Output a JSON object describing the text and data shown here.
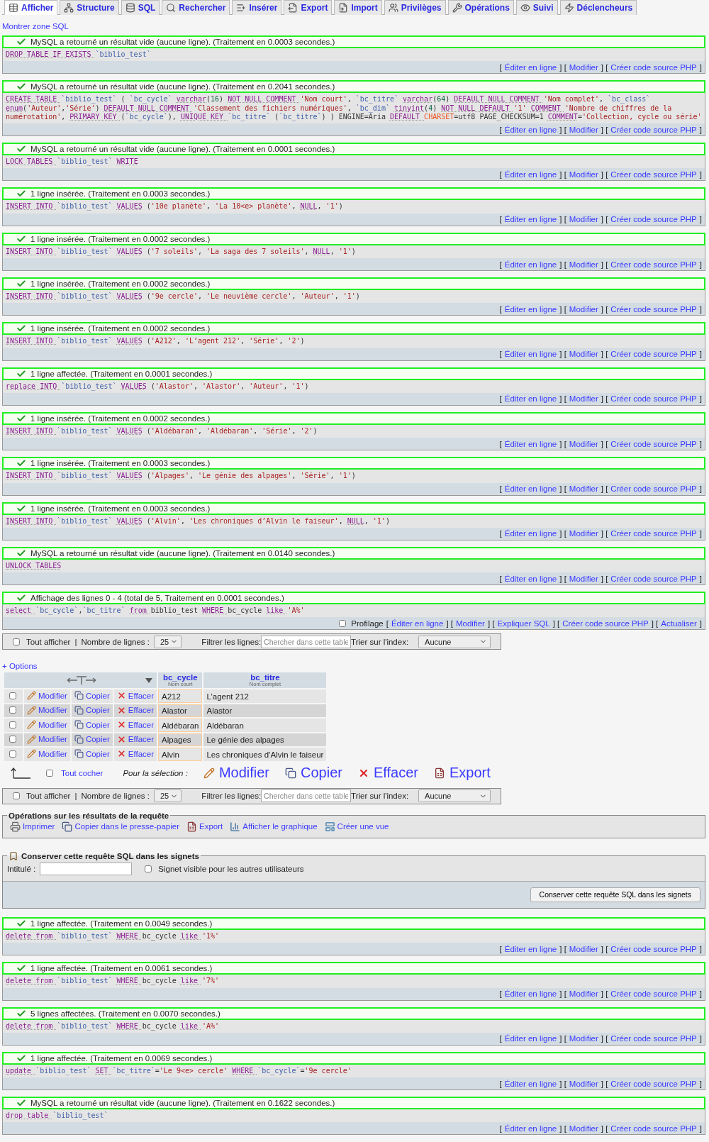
{
  "tabs": [
    {
      "kind": "browse",
      "label": "Afficher",
      "selected": true
    },
    {
      "kind": "structure",
      "label": "Structure",
      "selected": false
    },
    {
      "kind": "sql",
      "label": "SQL",
      "selected": false
    },
    {
      "kind": "search",
      "label": "Rechercher",
      "selected": false
    },
    {
      "kind": "insert",
      "label": "Insérer",
      "selected": false
    },
    {
      "kind": "export",
      "label": "Export",
      "selected": false
    },
    {
      "kind": "import",
      "label": "Import",
      "selected": false
    },
    {
      "kind": "privileges",
      "label": "Privilèges",
      "selected": false
    },
    {
      "kind": "operations",
      "label": "Opérations",
      "selected": false
    },
    {
      "kind": "tracking",
      "label": "Suivi",
      "selected": false
    },
    {
      "kind": "triggers",
      "label": "Déclencheurs",
      "selected": false
    }
  ],
  "sql_toggle": "Montrer zone SQL",
  "queries_before": [
    {
      "message": "MySQL a retourné un résultat vide (aucune ligne). (Traitement en 0.0003 secondes.)",
      "sql": [
        {
          "kw": "DROP TABLE IF EXISTS "
        },
        {
          "id": "`biblio_test`"
        }
      ],
      "actions": [
        {
          "text": "["
        },
        {
          "link": "Éditer en ligne"
        },
        {
          "text": "] ["
        },
        {
          "link": "Modifier"
        },
        {
          "text": "] ["
        },
        {
          "link": "Créer code source PHP"
        },
        {
          "text": "]"
        }
      ]
    },
    {
      "message": "MySQL a retourné un résultat vide (aucune ligne). (Traitement en 0.2041 secondes.)",
      "sql": [
        {
          "kw": "CREATE TABLE "
        },
        {
          "id": "`biblio_test` "
        },
        {
          "op": "( "
        },
        {
          "id": "`bc_cycle` "
        },
        {
          "kw": "varchar"
        },
        {
          "op": "("
        },
        {
          "num": "16"
        },
        {
          "op": ") "
        },
        {
          "kw": "NOT NULL COMMENT "
        },
        {
          "str": "'Nom court'"
        },
        {
          "op": ", "
        },
        {
          "id": "`bc_titre` "
        },
        {
          "kw": "varchar"
        },
        {
          "op": "("
        },
        {
          "num": "64"
        },
        {
          "op": ") "
        },
        {
          "kw": "DEFAULT NULL COMMENT "
        },
        {
          "str": "'Nom complet'"
        },
        {
          "op": ", "
        },
        {
          "id": "`bc_class` "
        },
        {
          "kw": "enum"
        },
        {
          "op": "("
        },
        {
          "str": "'Auteur'"
        },
        {
          "op": ","
        },
        {
          "str": "'Série'"
        },
        {
          "op": ") "
        },
        {
          "kw": "DEFAULT NULL COMMENT "
        },
        {
          "str": "'Classement des fichiers numériques'"
        },
        {
          "op": ", "
        },
        {
          "id": "`bc_dim` "
        },
        {
          "kw": "tinyint"
        },
        {
          "op": "("
        },
        {
          "num": "4"
        },
        {
          "op": ") "
        },
        {
          "kw": "NOT NULL DEFAULT "
        },
        {
          "str": "'1' "
        },
        {
          "kw": "COMMENT "
        },
        {
          "str": "'Nombre de chiffres de la numérotation'"
        },
        {
          "op": ", "
        },
        {
          "kw": "PRIMARY KEY "
        },
        {
          "op": "("
        },
        {
          "id": "`bc_cycle`"
        },
        {
          "op": "), "
        },
        {
          "kw": "UNIQUE KEY "
        },
        {
          "id": "`bc_titre` "
        },
        {
          "op": "("
        },
        {
          "id": "`bc_titre`"
        },
        {
          "op": ") ) ENGINE=Aria "
        },
        {
          "kw": "DEFAULT "
        },
        {
          "var": "CHARSET"
        },
        {
          "op": "=utf8 PAGE_CHECKSUM=1 "
        },
        {
          "kw": "COMMENT"
        },
        {
          "op": "="
        },
        {
          "str": "'Collection, cycle ou série'"
        }
      ],
      "actions": [
        {
          "text": "["
        },
        {
          "link": "Éditer en ligne"
        },
        {
          "text": "] ["
        },
        {
          "link": "Modifier"
        },
        {
          "text": "] ["
        },
        {
          "link": "Créer code source PHP"
        },
        {
          "text": "]"
        }
      ]
    },
    {
      "message": "MySQL a retourné un résultat vide (aucune ligne). (Traitement en 0.0001 secondes.)",
      "sql": [
        {
          "kw": "LOCK TABLES "
        },
        {
          "id": "`biblio_test` "
        },
        {
          "kw": "WRITE"
        }
      ],
      "actions": [
        {
          "text": "["
        },
        {
          "link": "Éditer en ligne"
        },
        {
          "text": "] ["
        },
        {
          "link": "Modifier"
        },
        {
          "text": "] ["
        },
        {
          "link": "Créer code source PHP"
        },
        {
          "text": "]"
        }
      ]
    },
    {
      "message": "1 ligne insérée. (Traitement en 0.0003 secondes.)",
      "sql": [
        {
          "kw": "INSERT INTO "
        },
        {
          "id": "`biblio_test` "
        },
        {
          "kw": "VALUES"
        },
        {
          "op": " ("
        },
        {
          "str": "'10e planète'"
        },
        {
          "op": ", "
        },
        {
          "str": "'La 10<e> planète'"
        },
        {
          "op": ", "
        },
        {
          "kw": "NULL"
        },
        {
          "op": ", "
        },
        {
          "str": "'1'"
        },
        {
          "op": ")"
        }
      ],
      "actions": [
        {
          "text": "["
        },
        {
          "link": "Éditer en ligne"
        },
        {
          "text": "] ["
        },
        {
          "link": "Modifier"
        },
        {
          "text": "] ["
        },
        {
          "link": "Créer code source PHP"
        },
        {
          "text": "]"
        }
      ]
    },
    {
      "message": "1 ligne insérée. (Traitement en 0.0002 secondes.)",
      "sql": [
        {
          "kw": "INSERT INTO "
        },
        {
          "id": "`biblio_test` "
        },
        {
          "kw": "VALUES"
        },
        {
          "op": " ("
        },
        {
          "str": "'7 soleils'"
        },
        {
          "op": ", "
        },
        {
          "str": "'La saga des 7 soleils'"
        },
        {
          "op": ", "
        },
        {
          "kw": "NULL"
        },
        {
          "op": ", "
        },
        {
          "str": "'1'"
        },
        {
          "op": ")"
        }
      ],
      "actions": [
        {
          "text": "["
        },
        {
          "link": "Éditer en ligne"
        },
        {
          "text": "] ["
        },
        {
          "link": "Modifier"
        },
        {
          "text": "] ["
        },
        {
          "link": "Créer code source PHP"
        },
        {
          "text": "]"
        }
      ]
    },
    {
      "message": "1 ligne insérée. (Traitement en 0.0002 secondes.)",
      "sql": [
        {
          "kw": "INSERT INTO "
        },
        {
          "id": "`biblio_test` "
        },
        {
          "kw": "VALUES"
        },
        {
          "op": " ("
        },
        {
          "str": "'9e cercle'"
        },
        {
          "op": ", "
        },
        {
          "str": "'Le neuvième cercle'"
        },
        {
          "op": ", "
        },
        {
          "str": "'Auteur'"
        },
        {
          "op": ", "
        },
        {
          "str": "'1'"
        },
        {
          "op": ")"
        }
      ],
      "actions": [
        {
          "text": "["
        },
        {
          "link": "Éditer en ligne"
        },
        {
          "text": "] ["
        },
        {
          "link": "Modifier"
        },
        {
          "text": "] ["
        },
        {
          "link": "Créer code source PHP"
        },
        {
          "text": "]"
        }
      ]
    },
    {
      "message": "1 ligne insérée. (Traitement en 0.0002 secondes.)",
      "sql": [
        {
          "kw": "INSERT INTO "
        },
        {
          "id": "`biblio_test` "
        },
        {
          "kw": "VALUES"
        },
        {
          "op": " ("
        },
        {
          "str": "'A212'"
        },
        {
          "op": ", "
        },
        {
          "str": "'L’agent 212'"
        },
        {
          "op": ", "
        },
        {
          "str": "'Série'"
        },
        {
          "op": ", "
        },
        {
          "str": "'2'"
        },
        {
          "op": ")"
        }
      ],
      "actions": [
        {
          "text": "["
        },
        {
          "link": "Éditer en ligne"
        },
        {
          "text": "] ["
        },
        {
          "link": "Modifier"
        },
        {
          "text": "] ["
        },
        {
          "link": "Créer code source PHP"
        },
        {
          "text": "]"
        }
      ]
    },
    {
      "message": "1 ligne affectée. (Traitement en 0.0001 secondes.)",
      "sql": [
        {
          "kw": "replace INTO "
        },
        {
          "id": "`biblio_test` "
        },
        {
          "kw": "VALUES"
        },
        {
          "op": " ("
        },
        {
          "str": "'Alastor'"
        },
        {
          "op": ", "
        },
        {
          "str": "'Alastor'"
        },
        {
          "op": ", "
        },
        {
          "str": "'Auteur'"
        },
        {
          "op": ", "
        },
        {
          "str": "'1'"
        },
        {
          "op": ")"
        }
      ],
      "actions": [
        {
          "text": "["
        },
        {
          "link": "Éditer en ligne"
        },
        {
          "text": "] ["
        },
        {
          "link": "Modifier"
        },
        {
          "text": "] ["
        },
        {
          "link": "Créer code source PHP"
        },
        {
          "text": "]"
        }
      ]
    },
    {
      "message": "1 ligne insérée. (Traitement en 0.0002 secondes.)",
      "sql": [
        {
          "kw": "INSERT INTO "
        },
        {
          "id": "`biblio_test` "
        },
        {
          "kw": "VALUES"
        },
        {
          "op": " ("
        },
        {
          "str": "'Aldébaran'"
        },
        {
          "op": ", "
        },
        {
          "str": "'Aldébaran'"
        },
        {
          "op": ", "
        },
        {
          "str": "'Série'"
        },
        {
          "op": ", "
        },
        {
          "str": "'2'"
        },
        {
          "op": ")"
        }
      ],
      "actions": [
        {
          "text": "["
        },
        {
          "link": "Éditer en ligne"
        },
        {
          "text": "] ["
        },
        {
          "link": "Modifier"
        },
        {
          "text": "] ["
        },
        {
          "link": "Créer code source PHP"
        },
        {
          "text": "]"
        }
      ]
    },
    {
      "message": "1 ligne insérée. (Traitement en 0.0003 secondes.)",
      "sql": [
        {
          "kw": "INSERT INTO "
        },
        {
          "id": "`biblio_test` "
        },
        {
          "kw": "VALUES"
        },
        {
          "op": " ("
        },
        {
          "str": "'Alpages'"
        },
        {
          "op": ", "
        },
        {
          "str": "'Le génie des alpages'"
        },
        {
          "op": ", "
        },
        {
          "str": "'Série'"
        },
        {
          "op": ", "
        },
        {
          "str": "'1'"
        },
        {
          "op": ")"
        }
      ],
      "actions": [
        {
          "text": "["
        },
        {
          "link": "Éditer en ligne"
        },
        {
          "text": "] ["
        },
        {
          "link": "Modifier"
        },
        {
          "text": "] ["
        },
        {
          "link": "Créer code source PHP"
        },
        {
          "text": "]"
        }
      ]
    },
    {
      "message": "1 ligne insérée. (Traitement en 0.0003 secondes.)",
      "sql": [
        {
          "kw": "INSERT INTO "
        },
        {
          "id": "`biblio_test` "
        },
        {
          "kw": "VALUES"
        },
        {
          "op": " ("
        },
        {
          "str": "'Alvin'"
        },
        {
          "op": ", "
        },
        {
          "str": "'Les chroniques d’Alvin le faiseur'"
        },
        {
          "op": ", "
        },
        {
          "kw": "NULL"
        },
        {
          "op": ", "
        },
        {
          "str": "'1'"
        },
        {
          "op": ")"
        }
      ],
      "actions": [
        {
          "text": "["
        },
        {
          "link": "Éditer en ligne"
        },
        {
          "text": "] ["
        },
        {
          "link": "Modifier"
        },
        {
          "text": "] ["
        },
        {
          "link": "Créer code source PHP"
        },
        {
          "text": "]"
        }
      ]
    },
    {
      "message": "MySQL a retourné un résultat vide (aucune ligne). (Traitement en 0.0140 secondes.)",
      "sql": [
        {
          "kw": "UNLOCK TABLES"
        }
      ],
      "actions": [
        {
          "text": "["
        },
        {
          "link": "Éditer en ligne"
        },
        {
          "text": "] ["
        },
        {
          "link": "Modifier"
        },
        {
          "text": "] ["
        },
        {
          "link": "Créer code source PHP"
        },
        {
          "text": "]"
        }
      ]
    }
  ],
  "result": {
    "message": "Affichage des lignes 0 - 4 (total de 5, Traitement en 0.0001 secondes.)",
    "sql": [
      {
        "kw": "select "
      },
      {
        "id": "`bc_cycle`"
      },
      {
        "op": ","
      },
      {
        "id": "`bc_titre` "
      },
      {
        "kw": "from "
      },
      {
        "op": "biblio_test "
      },
      {
        "kw": "WHERE "
      },
      {
        "op": "bc_cycle "
      },
      {
        "kw": "like "
      },
      {
        "str": "'A%'"
      }
    ],
    "profiling": {
      "label": "Profilage",
      "checked": false
    },
    "actions": [
      {
        "text": "["
      },
      {
        "link": "Éditer en ligne"
      },
      {
        "text": "] ["
      },
      {
        "link": "Modifier"
      },
      {
        "text": "] ["
      },
      {
        "link": "Expliquer SQL"
      },
      {
        "text": "] ["
      },
      {
        "link": "Créer code source PHP"
      },
      {
        "text": "] ["
      },
      {
        "link": "Actualiser"
      },
      {
        "text": "]"
      }
    ],
    "navigation_top": {
      "show_all": {
        "label": "Tout afficher",
        "checked": false
      },
      "separator": "|",
      "rows_label": "Nombre de lignes :",
      "rows_value": "25",
      "filter_label": "Filtrer les lignes:",
      "filter_placeholder": "Chercher dans cette table",
      "sort_label": "Trier sur l'index:",
      "sort_value": "Aucune"
    },
    "options": "+ Options",
    "table": {
      "columns": [
        {
          "name": "bc_cycle",
          "comment": "Nom court"
        },
        {
          "name": "bc_titre",
          "comment": "Nom complet"
        }
      ],
      "rows": [
        {
          "checked": false,
          "actions": [
            {
              "kind": "edit",
              "label": "Modifier"
            },
            {
              "kind": "copy",
              "label": "Copier"
            },
            {
              "kind": "delete",
              "label": "Effacer"
            }
          ],
          "cells": [
            "A212",
            "L’agent 212"
          ]
        },
        {
          "checked": false,
          "actions": [
            {
              "kind": "edit",
              "label": "Modifier"
            },
            {
              "kind": "copy",
              "label": "Copier"
            },
            {
              "kind": "delete",
              "label": "Effacer"
            }
          ],
          "cells": [
            "Alastor",
            "Alastor"
          ]
        },
        {
          "checked": false,
          "actions": [
            {
              "kind": "edit",
              "label": "Modifier"
            },
            {
              "kind": "copy",
              "label": "Copier"
            },
            {
              "kind": "delete",
              "label": "Effacer"
            }
          ],
          "cells": [
            "Aldébaran",
            "Aldébaran"
          ]
        },
        {
          "checked": false,
          "actions": [
            {
              "kind": "edit",
              "label": "Modifier"
            },
            {
              "kind": "copy",
              "label": "Copier"
            },
            {
              "kind": "delete",
              "label": "Effacer"
            }
          ],
          "cells": [
            "Alpages",
            "Le génie des alpages"
          ]
        },
        {
          "checked": false,
          "actions": [
            {
              "kind": "edit",
              "label": "Modifier"
            },
            {
              "kind": "copy",
              "label": "Copier"
            },
            {
              "kind": "delete",
              "label": "Effacer"
            }
          ],
          "cells": [
            "Alvin",
            "Les chroniques d’Alvin le faiseur"
          ]
        }
      ]
    },
    "selection": {
      "check_all": {
        "label": "Tout cocher",
        "checked": false
      },
      "label": "Pour la sélection :",
      "actions": [
        {
          "kind": "edit",
          "label": "Modifier"
        },
        {
          "kind": "copy",
          "label": "Copier"
        },
        {
          "kind": "delete",
          "label": "Effacer"
        },
        {
          "kind": "export",
          "label": "Export"
        }
      ]
    },
    "navigation_bottom": {
      "show_all": {
        "label": "Tout afficher",
        "checked": false
      },
      "separator": "|",
      "rows_label": "Nombre de lignes :",
      "rows_value": "25",
      "filter_label": "Filtrer les lignes:",
      "filter_placeholder": "Chercher dans cette table",
      "sort_label": "Trier sur l'index:",
      "sort_value": "Aucune"
    },
    "operations": {
      "legend": "Opérations sur les résultats de la requête",
      "actions": [
        {
          "kind": "print",
          "label": "Imprimer"
        },
        {
          "kind": "copy",
          "label": "Copier dans le presse-papier"
        },
        {
          "kind": "export",
          "label": "Export"
        },
        {
          "kind": "chart",
          "label": "Afficher le graphique"
        },
        {
          "kind": "view",
          "label": "Créer une vue"
        }
      ]
    },
    "bookmark": {
      "legend": "Conserver cette requête SQL dans les signets",
      "title_label": "Intitulé :",
      "visible": {
        "label": "Signet visible pour les autres utilisateurs",
        "checked": false
      },
      "button": "Conserver cette requête SQL dans les signets"
    }
  },
  "queries_after": [
    {
      "message": "1 ligne affectée. (Traitement en 0.0049 secondes.)",
      "sql": [
        {
          "kw": "delete from "
        },
        {
          "id": "`biblio_test` "
        },
        {
          "kw": "WHERE "
        },
        {
          "op": "bc_cycle "
        },
        {
          "kw": "like "
        },
        {
          "str": "'1%'"
        }
      ],
      "actions": [
        {
          "text": "["
        },
        {
          "link": "Éditer en ligne"
        },
        {
          "text": "] ["
        },
        {
          "link": "Modifier"
        },
        {
          "text": "] ["
        },
        {
          "link": "Créer code source PHP"
        },
        {
          "text": "]"
        }
      ]
    },
    {
      "message": "1 ligne affectée. (Traitement en 0.0061 secondes.)",
      "sql": [
        {
          "kw": "delete from "
        },
        {
          "id": "`biblio_test` "
        },
        {
          "kw": "WHERE "
        },
        {
          "op": "bc_cycle "
        },
        {
          "kw": "like "
        },
        {
          "str": "'7%'"
        }
      ],
      "actions": [
        {
          "text": "["
        },
        {
          "link": "Éditer en ligne"
        },
        {
          "text": "] ["
        },
        {
          "link": "Modifier"
        },
        {
          "text": "] ["
        },
        {
          "link": "Créer code source PHP"
        },
        {
          "text": "]"
        }
      ]
    },
    {
      "message": "5 lignes affectées. (Traitement en 0.0070 secondes.)",
      "sql": [
        {
          "kw": "delete from "
        },
        {
          "id": "`biblio_test` "
        },
        {
          "kw": "WHERE "
        },
        {
          "op": "bc_cycle "
        },
        {
          "kw": "like "
        },
        {
          "str": "'A%'"
        }
      ],
      "actions": [
        {
          "text": "["
        },
        {
          "link": "Éditer en ligne"
        },
        {
          "text": "] ["
        },
        {
          "link": "Modifier"
        },
        {
          "text": "] ["
        },
        {
          "link": "Créer code source PHP"
        },
        {
          "text": "]"
        }
      ]
    },
    {
      "message": "1 ligne affectée. (Traitement en 0.0069 secondes.)",
      "sql": [
        {
          "kw": "update "
        },
        {
          "id": "`biblio_test` "
        },
        {
          "kw": "SET "
        },
        {
          "id": "`bc_titre`"
        },
        {
          "op": "="
        },
        {
          "str": "'Le 9<e> cercle' "
        },
        {
          "kw": "WHERE "
        },
        {
          "id": "`bc_cycle`"
        },
        {
          "op": "="
        },
        {
          "str": "'9e cercle'"
        }
      ],
      "actions": [
        {
          "text": "["
        },
        {
          "link": "Éditer en ligne"
        },
        {
          "text": "] ["
        },
        {
          "link": "Modifier"
        },
        {
          "text": "] ["
        },
        {
          "link": "Créer code source PHP"
        },
        {
          "text": "]"
        }
      ]
    },
    {
      "message": "MySQL a retourné un résultat vide (aucune ligne). (Traitement en 0.1622 secondes.)",
      "sql": [
        {
          "kw": "drop table "
        },
        {
          "id": "`biblio_test`"
        }
      ],
      "actions": [
        {
          "text": "["
        },
        {
          "link": "Éditer en ligne"
        },
        {
          "text": "] ["
        },
        {
          "link": "Modifier"
        },
        {
          "text": "] ["
        },
        {
          "link": "Créer code source PHP"
        },
        {
          "text": "]"
        }
      ]
    }
  ]
}
